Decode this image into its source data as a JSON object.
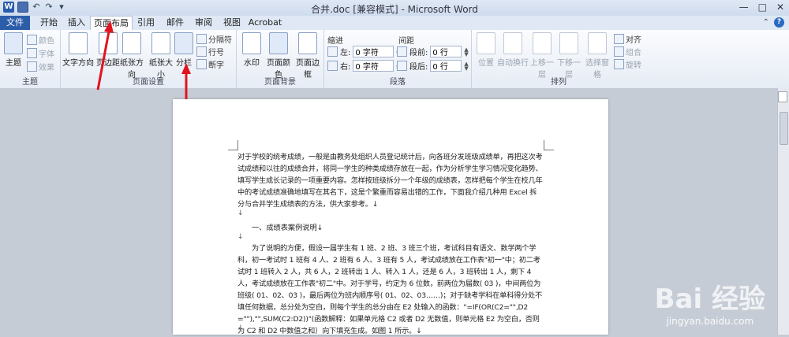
{
  "window": {
    "title": "合并.doc [兼容模式] - Microsoft Word",
    "word_logo": "W",
    "buttons": [
      "—",
      "□",
      "✕"
    ]
  },
  "tabs": [
    {
      "label": "文件"
    },
    {
      "label": "开始"
    },
    {
      "label": "插入"
    },
    {
      "label": "页面布局"
    },
    {
      "label": "引用"
    },
    {
      "label": "邮件"
    },
    {
      "label": "审阅"
    },
    {
      "label": "视图"
    },
    {
      "label": "Acrobat"
    }
  ],
  "help_label": "?",
  "ribbon": {
    "theme": {
      "big": "主题",
      "colors": "颜色",
      "fonts": "字体",
      "effects": "效果",
      "group": "主题"
    },
    "page_setup": {
      "text_direction": "文字方向",
      "margins": "页边距",
      "orientation": "纸张方向",
      "size": "纸张大小",
      "columns": "分栏",
      "breaks": "分隔符",
      "line_numbers": "行号",
      "hyphenation": "断字",
      "group": "页面设置"
    },
    "page_background": {
      "watermark": "水印",
      "page_color": "页面颜色",
      "page_borders": "页面边框",
      "group": "页面背景"
    },
    "paragraph": {
      "indent": "缩进",
      "left": "左:",
      "right": "右:",
      "left_value": "0 字符",
      "right_value": "0 字符",
      "spacing": "间距",
      "before": "段前:",
      "after": "段后:",
      "before_value": "0 行",
      "after_value": "0 行",
      "group": "段落"
    },
    "arrange": {
      "position": "位置",
      "wrap": "自动换行",
      "forward": "上移一层",
      "backward": "下移一层",
      "selection_pane": "选择窗格",
      "align": "对齐",
      "group_btn": "组合",
      "rotate": "旋转",
      "group": "排列"
    }
  },
  "document": {
    "para1": "对于学校的统考成绩，一般是由教务处组织人员登记统计后，向各班分发班级成绩单，再把这次考试成绩和以往的成绩合并，将同一学生的种类成绩存放在一起，作为分析学生学习情况变化趋势、填写学生成长记录的一项重要内容。怎样按班级拆分一个年级的成绩表，怎样把每个学生在校几年中的考试成绩准确地填写在其名下，这是个繁重而容易出错的工作，下面我介绍几种用 Excel 拆分与合并学生成绩表的方法，供大家参考。↓",
    "mark": "↓",
    "heading": "一、成绩表案例说明↓",
    "para2": "为了说明的方便，假设一届学生有 1 班、2 班、3 班三个班，考试科目有语文、数学两个学科，初一考试时 1 班有 4 人、2 班有 6 人、3 班有 5 人，考试成绩放在工作表\"初一\"中；初二考试时 1 班转入 2 人，共 6 人，2 班转出 1 人、转入 1 人，还是 6 人，3 班转出 1 人，剩下 4 人，考试成绩放在工作表\"初二\"中。对于学号，约定为 6 位数，前两位为届数( 03 )，中间两位为班级( 01、02、03 )，最后两位为班内顺序号( 01、02、03……)；对于缺考学科在单科得分处不填任何数据，总分处为空白，则每个学生的总分由在 E2 处输入的函数：\"=IF(OR(C2=\"\",D2=\"\"),\"\",SUM(C2:D2))\"(函数解释：如果单元格 C2 或者 D2 无数值，则单元格 E2 为空白，否则为 C2 和 D2 中数值之和）向下填充生成。如图 1 所示。↓",
    "mark_end": "↓"
  },
  "watermark": {
    "brand": "Bai 经验",
    "url": "jingyan.baidu.com"
  },
  "colors": {
    "accent": "#2c5da8",
    "annotation_arrow": "#e0141e"
  }
}
